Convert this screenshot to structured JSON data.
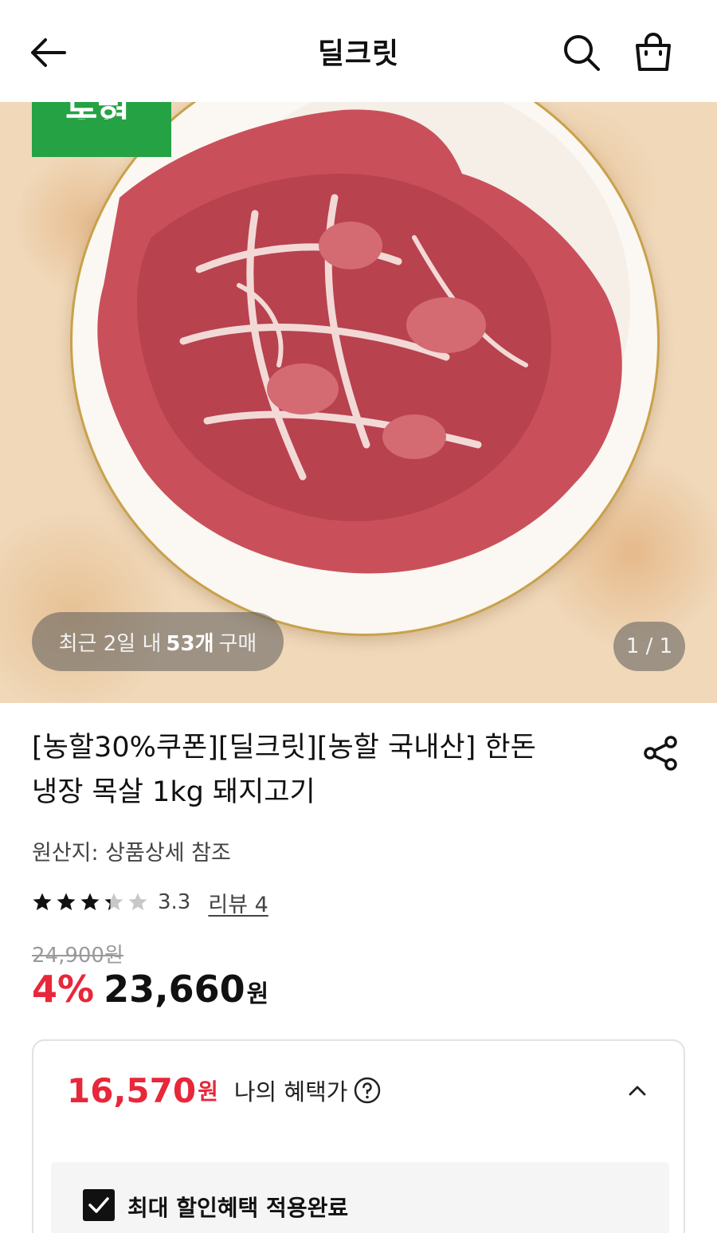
{
  "header": {
    "title": "딜크릿"
  },
  "hero": {
    "badge_text": "농협",
    "purchase_prefix": "최근 2일 내",
    "purchase_count": "53개",
    "purchase_suffix": "구매",
    "page_indicator": "1 / 1"
  },
  "product": {
    "title_line1": "[농할30%쿠폰][딜크릿][농할 국내산] 한돈",
    "title_line2": "냉장 목살 1kg 돼지고기",
    "origin": "원산지: 상품상세 참조",
    "rating": 3.3,
    "rating_text": "3.3",
    "review_link": "리뷰 4",
    "original_price": "24,900원",
    "discount_rate": "4%",
    "sale_price": "23,660",
    "price_unit": "원"
  },
  "benefit": {
    "price": "16,570",
    "price_unit": "원",
    "label": "나의 혜택가",
    "applied_label": "최대 할인혜택 적용완료"
  },
  "colors": {
    "accent_red": "#e8273a",
    "badge_green": "#25a244",
    "star_filled": "#111111",
    "star_empty": "#c8c8c8"
  },
  "icons": {
    "back": "arrow-left-icon",
    "search": "search-icon",
    "cart": "shopping-bag-icon",
    "share": "share-icon",
    "help": "question-circle-icon",
    "chevron": "chevron-up-icon",
    "check": "checkmark-icon"
  }
}
